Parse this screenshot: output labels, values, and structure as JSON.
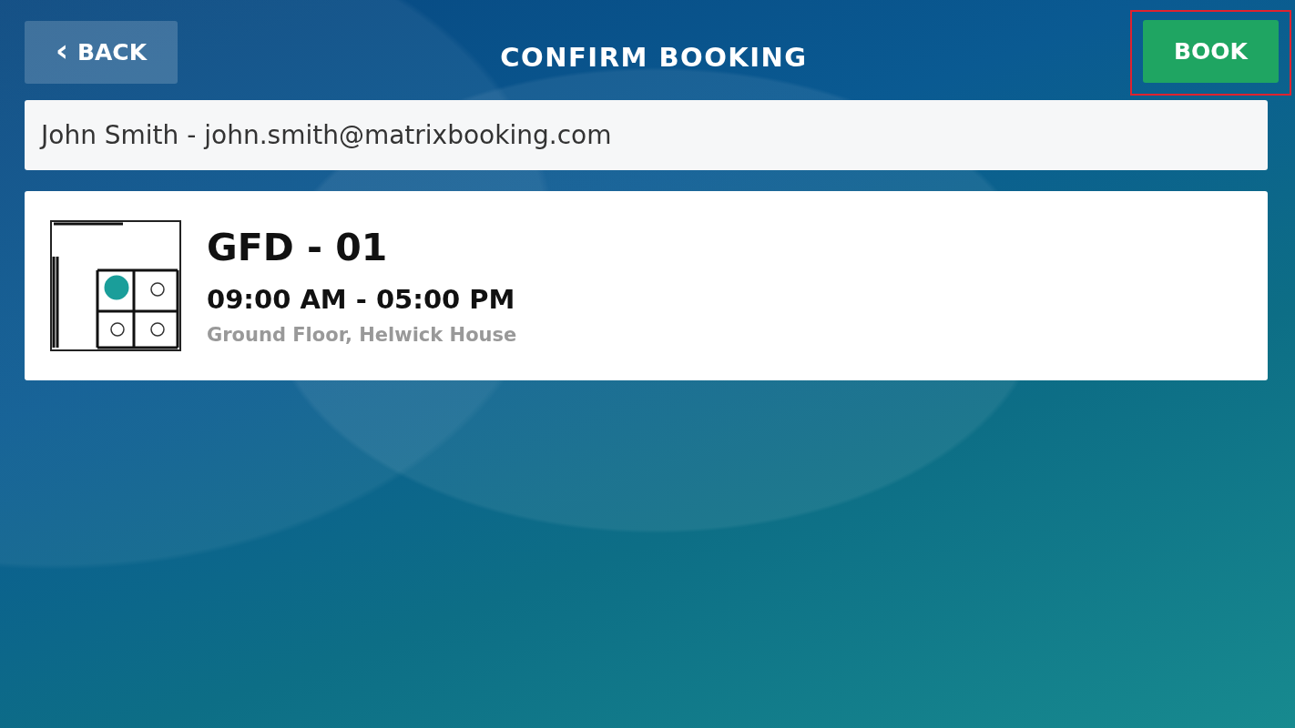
{
  "header": {
    "back": {
      "icon": "‹",
      "label": "BACK"
    },
    "title": "CONFIRM BOOKING",
    "book": {
      "label": "BOOK",
      "highlighted": true
    }
  },
  "user": {
    "value": "John Smith - john.smith@matrixbooking.com"
  },
  "booking": {
    "name": "GFD - 01",
    "time": "09:00 AM - 05:00 PM",
    "location": "Ground Floor, Helwick House"
  }
}
